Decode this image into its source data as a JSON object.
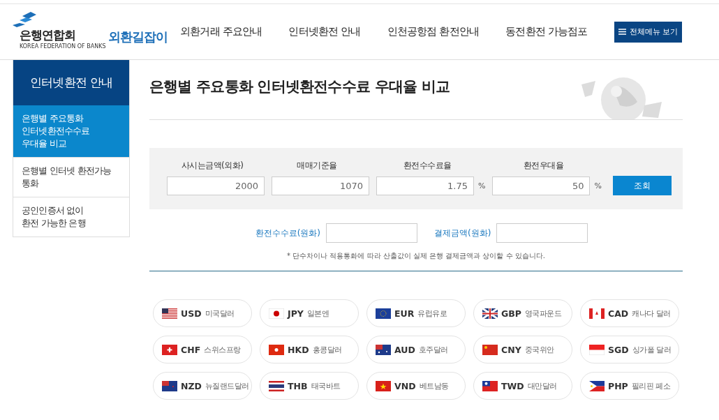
{
  "header": {
    "logo": {
      "name": "은행연합회",
      "subtitle": "KOREA FEDERATION OF BANKS",
      "service": "외환길잡이"
    },
    "nav": [
      "외환거래 주요안내",
      "인터넷환전 안내",
      "인천공항점 환전안내",
      "동전환전 가능점포"
    ],
    "menu_button": "전체메뉴 보기"
  },
  "sidebar": {
    "title": "인터넷환전 안내",
    "items": [
      {
        "label": "은행별 주요통화\n인터넷환전수수료\n우대율 비교",
        "selected": true
      },
      {
        "label": "은행별 인터넷 환전가능\n통화",
        "selected": false
      },
      {
        "label": "공인인증서 없이\n환전 가능한 은행",
        "selected": false
      }
    ]
  },
  "page_title": "은행별 주요통화 인터넷환전수수료 우대율 비교",
  "form": {
    "fields": [
      {
        "label": "사시는금액(외화)",
        "value": "2000"
      },
      {
        "label": "매매기준율",
        "value": "1070"
      },
      {
        "label": "환전수수료율",
        "value": "1.75",
        "unit": "%"
      },
      {
        "label": "환전우대율",
        "value": "50",
        "unit": "%"
      }
    ],
    "submit": "조회"
  },
  "results": [
    {
      "label": "환전수수료(원화)"
    },
    {
      "label": "결제금액(원화)"
    }
  ],
  "note": "* 단수차이나 적용통화에 따라 산출값이 실제 은행 결제금액과 상이할 수 있습니다.",
  "currencies": [
    {
      "code": "USD",
      "name": "미국달러"
    },
    {
      "code": "JPY",
      "name": "일본엔"
    },
    {
      "code": "EUR",
      "name": "유럽유로"
    },
    {
      "code": "GBP",
      "name": "영국파운드"
    },
    {
      "code": "CAD",
      "name": "캐나다 달러"
    },
    {
      "code": "CHF",
      "name": "스위스프랑"
    },
    {
      "code": "HKD",
      "name": "홍콩달러"
    },
    {
      "code": "AUD",
      "name": "호주달러"
    },
    {
      "code": "CNY",
      "name": "중국위안"
    },
    {
      "code": "SGD",
      "name": "싱가폴 달러"
    },
    {
      "code": "NZD",
      "name": "뉴질랜드달러"
    },
    {
      "code": "THB",
      "name": "태국바트"
    },
    {
      "code": "VND",
      "name": "베트남동"
    },
    {
      "code": "TWD",
      "name": "대만달러"
    },
    {
      "code": "PHP",
      "name": "필리핀 페소"
    }
  ]
}
